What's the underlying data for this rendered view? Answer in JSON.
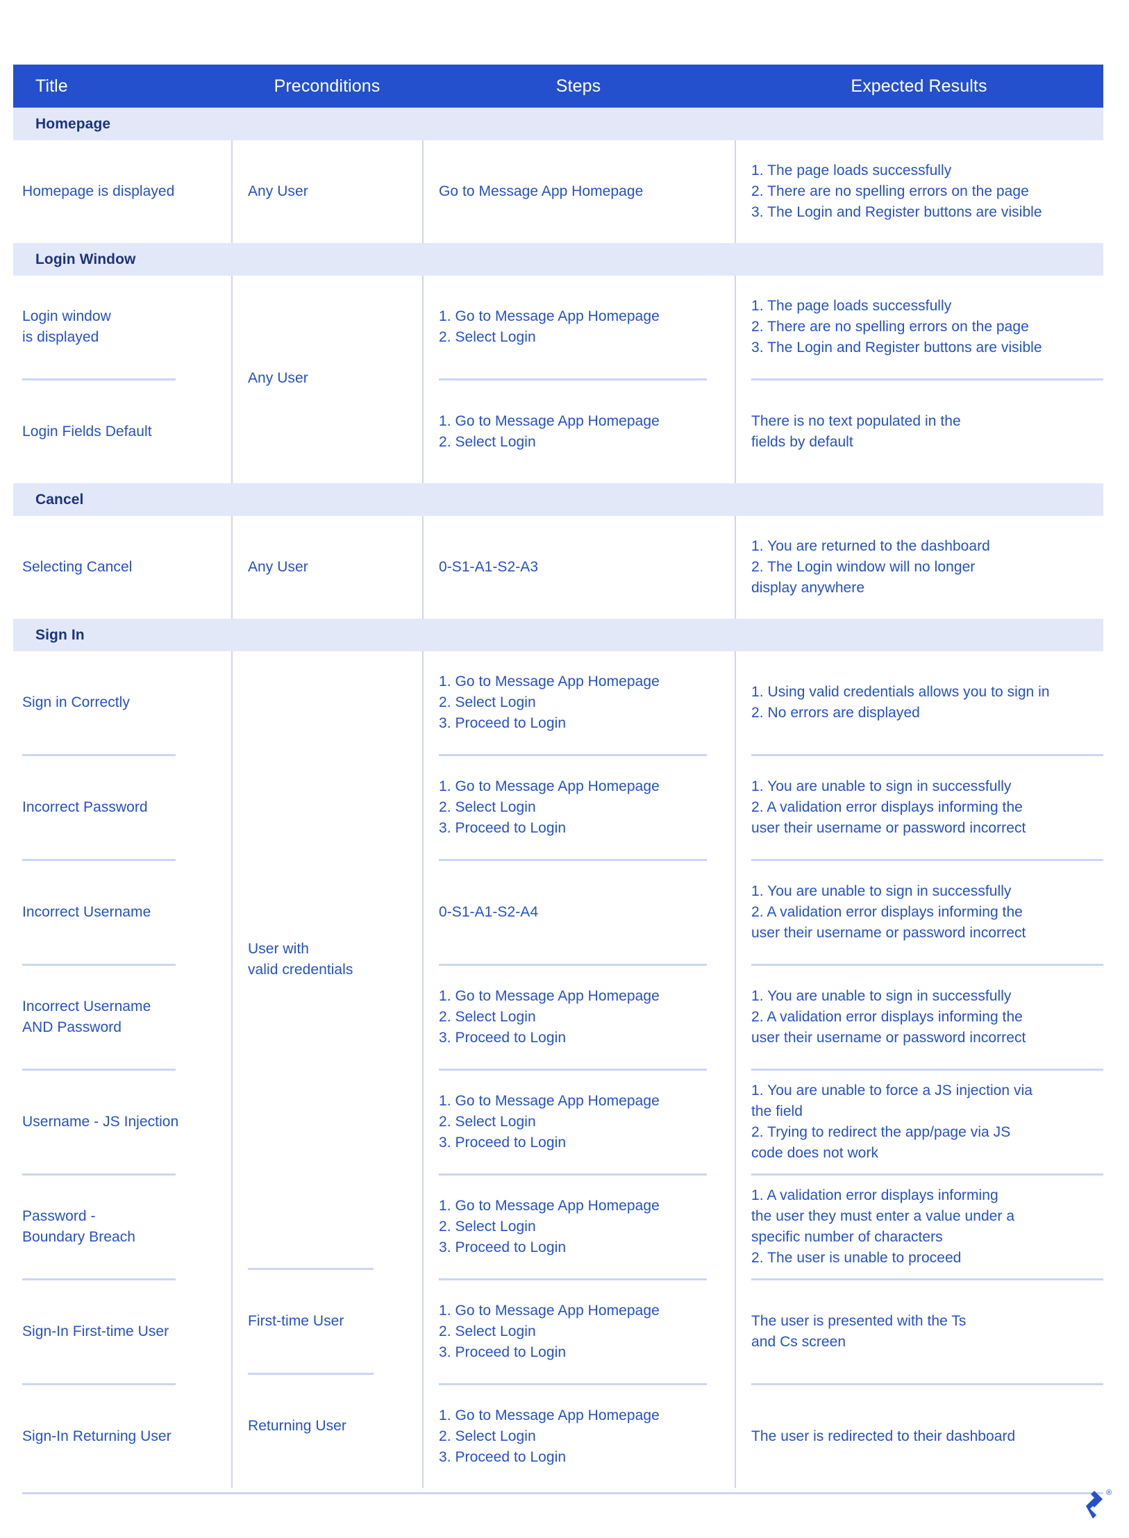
{
  "document": {
    "type": "test-case-table",
    "accent_color": "#2450ce",
    "band_color": "#e3e8f9",
    "rule_color": "#ccd6f2",
    "text_color": "#2450ce",
    "section_text_color": "#1a347f",
    "header_text_color": "#ffffff"
  },
  "table": {
    "columns": [
      {
        "key": "title",
        "label": "Title"
      },
      {
        "key": "pre",
        "label": "Preconditions"
      },
      {
        "key": "steps",
        "label": "Steps"
      },
      {
        "key": "expected",
        "label": "Expected Results"
      }
    ],
    "sections": [
      {
        "name": "Homepage",
        "precondition_groups": [
          {
            "precondition": [
              "Any User"
            ],
            "rows": [
              {
                "title": [
                  "Homepage is displayed"
                ],
                "steps": [
                  "Go to Message App Homepage"
                ],
                "expected": [
                  "1. The page loads successfully",
                  "2. There are no spelling errors on the page",
                  "3. The Login and Register buttons are visible"
                ]
              }
            ]
          }
        ]
      },
      {
        "name": "Login Window",
        "precondition_groups": [
          {
            "precondition": [
              "Any User"
            ],
            "rows": [
              {
                "title": [
                  "Login window",
                  "is displayed"
                ],
                "steps": [
                  "1. Go to Message App Homepage",
                  "2. Select Login"
                ],
                "expected": [
                  "1. The page loads successfully",
                  "2. There are no spelling errors on the page",
                  "3. The Login and Register buttons are visible"
                ]
              },
              {
                "title": [
                  "Login Fields Default"
                ],
                "steps": [
                  "1. Go to Message App Homepage",
                  "2. Select Login"
                ],
                "expected": [
                  "There is no text populated in the",
                  "fields by default"
                ]
              }
            ]
          }
        ]
      },
      {
        "name": "Cancel",
        "precondition_groups": [
          {
            "precondition": [
              "Any User"
            ],
            "rows": [
              {
                "title": [
                  "Selecting Cancel"
                ],
                "steps": [
                  "0-S1-A1-S2-A3"
                ],
                "expected": [
                  "1. You are returned to the dashboard",
                  "2. The Login window will no longer",
                  "display anywhere"
                ]
              }
            ]
          }
        ]
      },
      {
        "name": "Sign In",
        "precondition_groups": [
          {
            "precondition": [
              "User with",
              "valid credentials"
            ],
            "rows": [
              {
                "title": [
                  "Sign in Correctly"
                ],
                "steps": [
                  "1. Go to Message App Homepage",
                  "2. Select Login",
                  "3. Proceed to Login"
                ],
                "expected": [
                  "1. Using valid credentials allows you to sign in",
                  "2. No errors are displayed"
                ]
              },
              {
                "title": [
                  "Incorrect Password"
                ],
                "steps": [
                  "1. Go to Message App Homepage",
                  "2. Select Login",
                  "3. Proceed to Login"
                ],
                "expected": [
                  "1. You are unable to sign in successfully",
                  "2. A validation error displays informing the",
                  "user their username or password incorrect"
                ]
              },
              {
                "title": [
                  "Incorrect Username"
                ],
                "steps": [
                  "0-S1-A1-S2-A4"
                ],
                "expected": [
                  "1. You are unable to sign in successfully",
                  "2. A validation error displays informing the",
                  "user their username or password incorrect"
                ]
              },
              {
                "title": [
                  "Incorrect Username",
                  "AND Password"
                ],
                "steps": [
                  "1. Go to Message App Homepage",
                  "2. Select Login",
                  "3. Proceed to Login"
                ],
                "expected": [
                  "1. You are unable to sign in successfully",
                  "2. A validation error displays informing the",
                  "user their username or password incorrect"
                ]
              },
              {
                "title": [
                  "Username - JS Injection"
                ],
                "steps": [
                  "1. Go to Message App Homepage",
                  "2. Select Login",
                  "3. Proceed to Login"
                ],
                "expected": [
                  "1. You are unable to force a JS injection via",
                  "the field",
                  "2. Trying to redirect the app/page via JS",
                  "code does not work"
                ]
              },
              {
                "title": [
                  "Password -",
                  "Boundary Breach"
                ],
                "steps": [
                  "1. Go to Message App Homepage",
                  "2. Select Login",
                  "3. Proceed to Login"
                ],
                "expected": [
                  "1. A validation error displays informing",
                  "the user they must enter a value under a",
                  "specific number of characters",
                  "2. The user is unable to proceed"
                ]
              }
            ]
          },
          {
            "precondition": [
              "First-time User"
            ],
            "rows": [
              {
                "title": [
                  "Sign-In First-time User"
                ],
                "steps": [
                  "1. Go to Message App Homepage",
                  "2. Select Login",
                  "3. Proceed to Login"
                ],
                "expected": [
                  "The user is presented with the Ts",
                  "and Cs screen"
                ]
              }
            ]
          },
          {
            "precondition": [
              "Returning User"
            ],
            "rows": [
              {
                "title": [
                  "Sign-In Returning User"
                ],
                "steps": [
                  "1. Go to Message App Homepage",
                  "2. Select Login",
                  "3. Proceed to Login"
                ],
                "expected": [
                  "The user is redirected to their dashboard"
                ]
              }
            ]
          }
        ]
      }
    ]
  },
  "footer": {
    "logo_name": "toptal-logo",
    "registered_mark": "®"
  }
}
